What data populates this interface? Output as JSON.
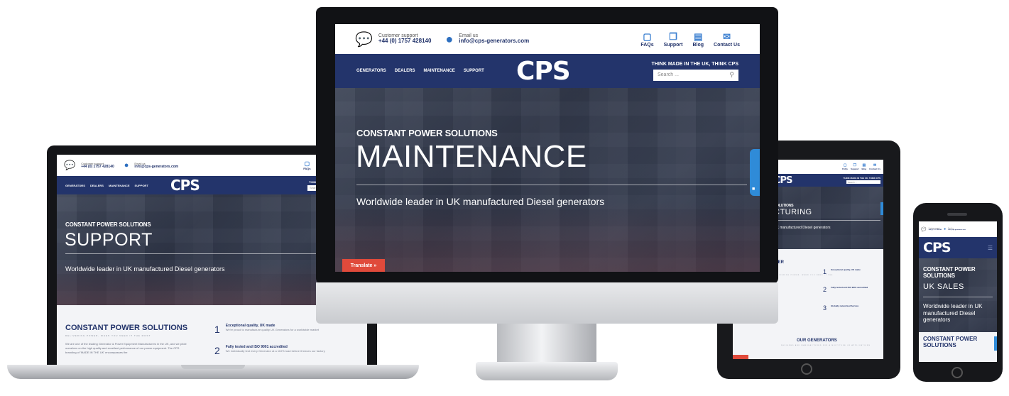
{
  "site": {
    "support_label": "Customer support",
    "support_phone": "+44 (0) 1757 428140",
    "email_label": "Email us",
    "email_value": "info@cps-generators.com",
    "quick_links": [
      {
        "label": "FAQs",
        "icon": "faq-icon"
      },
      {
        "label": "Support",
        "icon": "support-icon"
      },
      {
        "label": "Blog",
        "icon": "blog-icon"
      },
      {
        "label": "Contact Us",
        "icon": "contact-icon"
      }
    ],
    "nav": [
      "GENERATORS",
      "DEALERS",
      "MAINTENANCE",
      "SUPPORT"
    ],
    "logo": "CPS",
    "tagline": "THINK MADE IN THE UK, THINK CPS",
    "search_placeholder": "Search ...",
    "kicker": "CONSTANT POWER SOLUTIONS",
    "subtitle": "Worldwide leader in UK manufactured Diesel generators",
    "translate": "Translate »",
    "chat": "Chat with us"
  },
  "monitor": {
    "title": "MAINTENANCE"
  },
  "laptop": {
    "title": "SUPPORT",
    "section_title": "CONSTANT POWER SOLUTIONS",
    "section_tag": "DELIVERING POWER, WHEN YOU NEED IT THE MOST",
    "paragraph": "We are one of the leading Generator & Power Equipment Manufacturers in the UK, and we pride ourselves on the high quality and excellent performance of our power equipment. The CPS branding of 'MADE IN THE UK' encompasses the",
    "features": [
      {
        "num": "1",
        "title": "Exceptional quality, UK made",
        "text": "We're proud to manufacture quality UK Generators for a worldwide market"
      },
      {
        "num": "2",
        "title": "Fully tested and ISO 9001 accredited",
        "text": "We individually test every Generator at a 110% load before it leaves our factory"
      }
    ]
  },
  "tablet": {
    "kicker": "SOLUTIONS",
    "title": "CTURING",
    "subtitle": "UK manufactured Diesel generators",
    "section_title": "WER",
    "section_tag": "DELIVERING POWER, WHEN YOU NEED IT THE",
    "features": [
      {
        "num": "1",
        "title": "Exceptional quality, UK made"
      },
      {
        "num": "2",
        "title": "Fully tested and ISO 9001 accredited"
      },
      {
        "num": "3",
        "title": "Globally networked Service"
      }
    ],
    "generators_title": "OUR GENERATORS",
    "generators_tag": "DESIGNED AND MANUFACTURED FOR A MULTITUDE OF APPLICATIONS"
  },
  "phone": {
    "kicker": "CONSTANT POWER SOLUTIONS",
    "title": "UK SALES",
    "subtitle": "Worldwide leader in UK manufactured Diesel generators",
    "section_title": "CONSTANT POWER SOLUTIONS"
  },
  "colors": {
    "navy": "#23346b",
    "accent_blue": "#3b8fd6",
    "translate_red": "#e04a3b"
  }
}
